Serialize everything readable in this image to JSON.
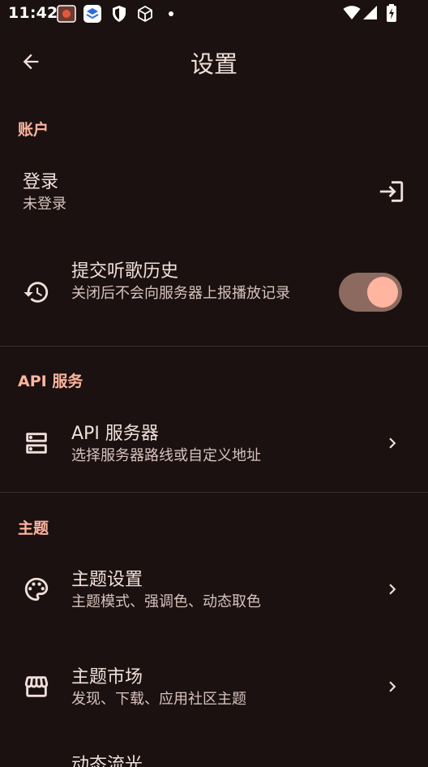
{
  "status_bar": {
    "time": "11:42"
  },
  "app_bar": {
    "title": "设置"
  },
  "sections": {
    "account": {
      "header": "账户",
      "login": {
        "title": "登录",
        "subtitle": "未登录"
      },
      "scrobble": {
        "title": "提交听歌历史",
        "subtitle": "关闭后不会向服务器上报播放记录",
        "enabled": true
      }
    },
    "api": {
      "header": "API 服务",
      "server": {
        "title": "API 服务器",
        "subtitle": "选择服务器路线或自定义地址"
      }
    },
    "theme": {
      "header": "主题",
      "settings": {
        "title": "主题设置",
        "subtitle": "主题模式、强调色、动态取色"
      },
      "market": {
        "title": "主题市场",
        "subtitle": "发现、下载、应用社区主题"
      },
      "flow": {
        "title": "动态流光"
      }
    }
  },
  "colors": {
    "background": "#1a1110",
    "accent": "#ffb59f",
    "text": "#f1dfda",
    "subtext": "#d8c2bc"
  },
  "icons": [
    "back-arrow-icon",
    "login-icon",
    "history-icon",
    "server-icon",
    "palette-icon",
    "store-icon",
    "chevron-right-icon"
  ]
}
